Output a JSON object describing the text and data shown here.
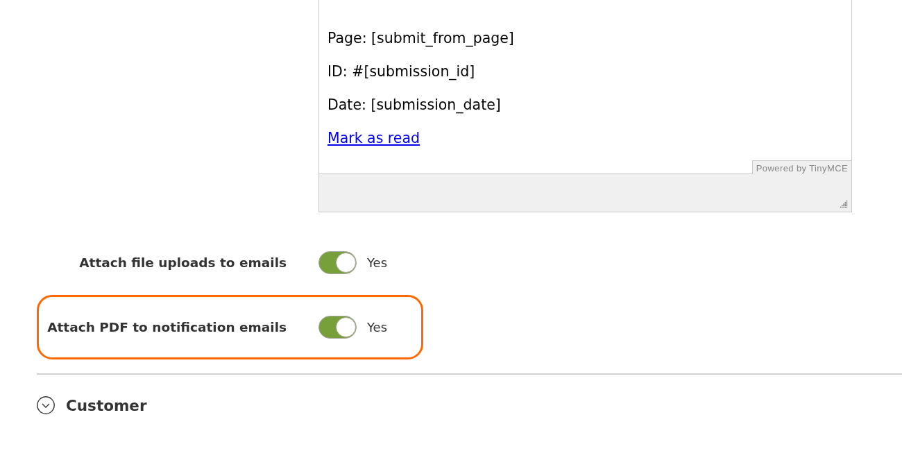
{
  "editor": {
    "paragraphs": [
      {
        "kind": "text",
        "text": "Page: [submit_from_page]"
      },
      {
        "kind": "text",
        "text": "ID: #[submission_id]"
      },
      {
        "kind": "text",
        "text": "Date: [submission_date]"
      },
      {
        "kind": "link",
        "text": "Mark as read"
      }
    ],
    "branding": "Powered by TinyMCE"
  },
  "settings": [
    {
      "label": "Attach file uploads to emails",
      "on": true,
      "value_label": "Yes",
      "highlighted": false
    },
    {
      "label": "Attach PDF to notification emails",
      "on": true,
      "value_label": "Yes",
      "highlighted": true
    }
  ],
  "section": {
    "title": "Customer",
    "expanded": false
  }
}
